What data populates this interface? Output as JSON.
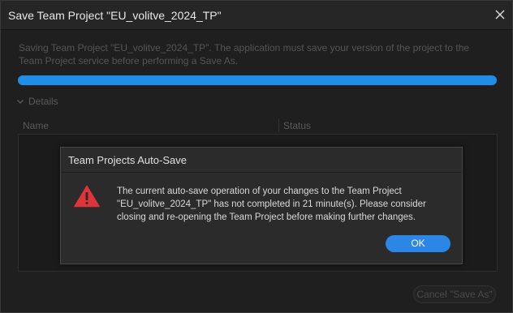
{
  "window": {
    "title": "Save Team Project \"EU_volitve_2024_TP\"",
    "close_icon": "close-icon"
  },
  "main": {
    "message": "Saving Team Project \"EU_volitve_2024_TP\". The application must save your version of the project to the Team Project service before performing a Save As.",
    "progress_fraction": 1.0,
    "details_label": "Details",
    "columns": [
      "Name",
      "Status"
    ],
    "cancel_label": "Cancel \"Save As\""
  },
  "modal": {
    "title": "Team Projects Auto-Save",
    "icon": "warning-icon",
    "message": "The current auto-save operation of your changes to the Team Project \"EU_volitve_2024_TP\" has not completed in 21 minute(s). Please consider closing and re-opening the Team Project before making further changes.",
    "ok_label": "OK"
  },
  "colors": {
    "accent": "#2b86e6",
    "warning": "#e0343a",
    "background": "#1f1f1f"
  }
}
